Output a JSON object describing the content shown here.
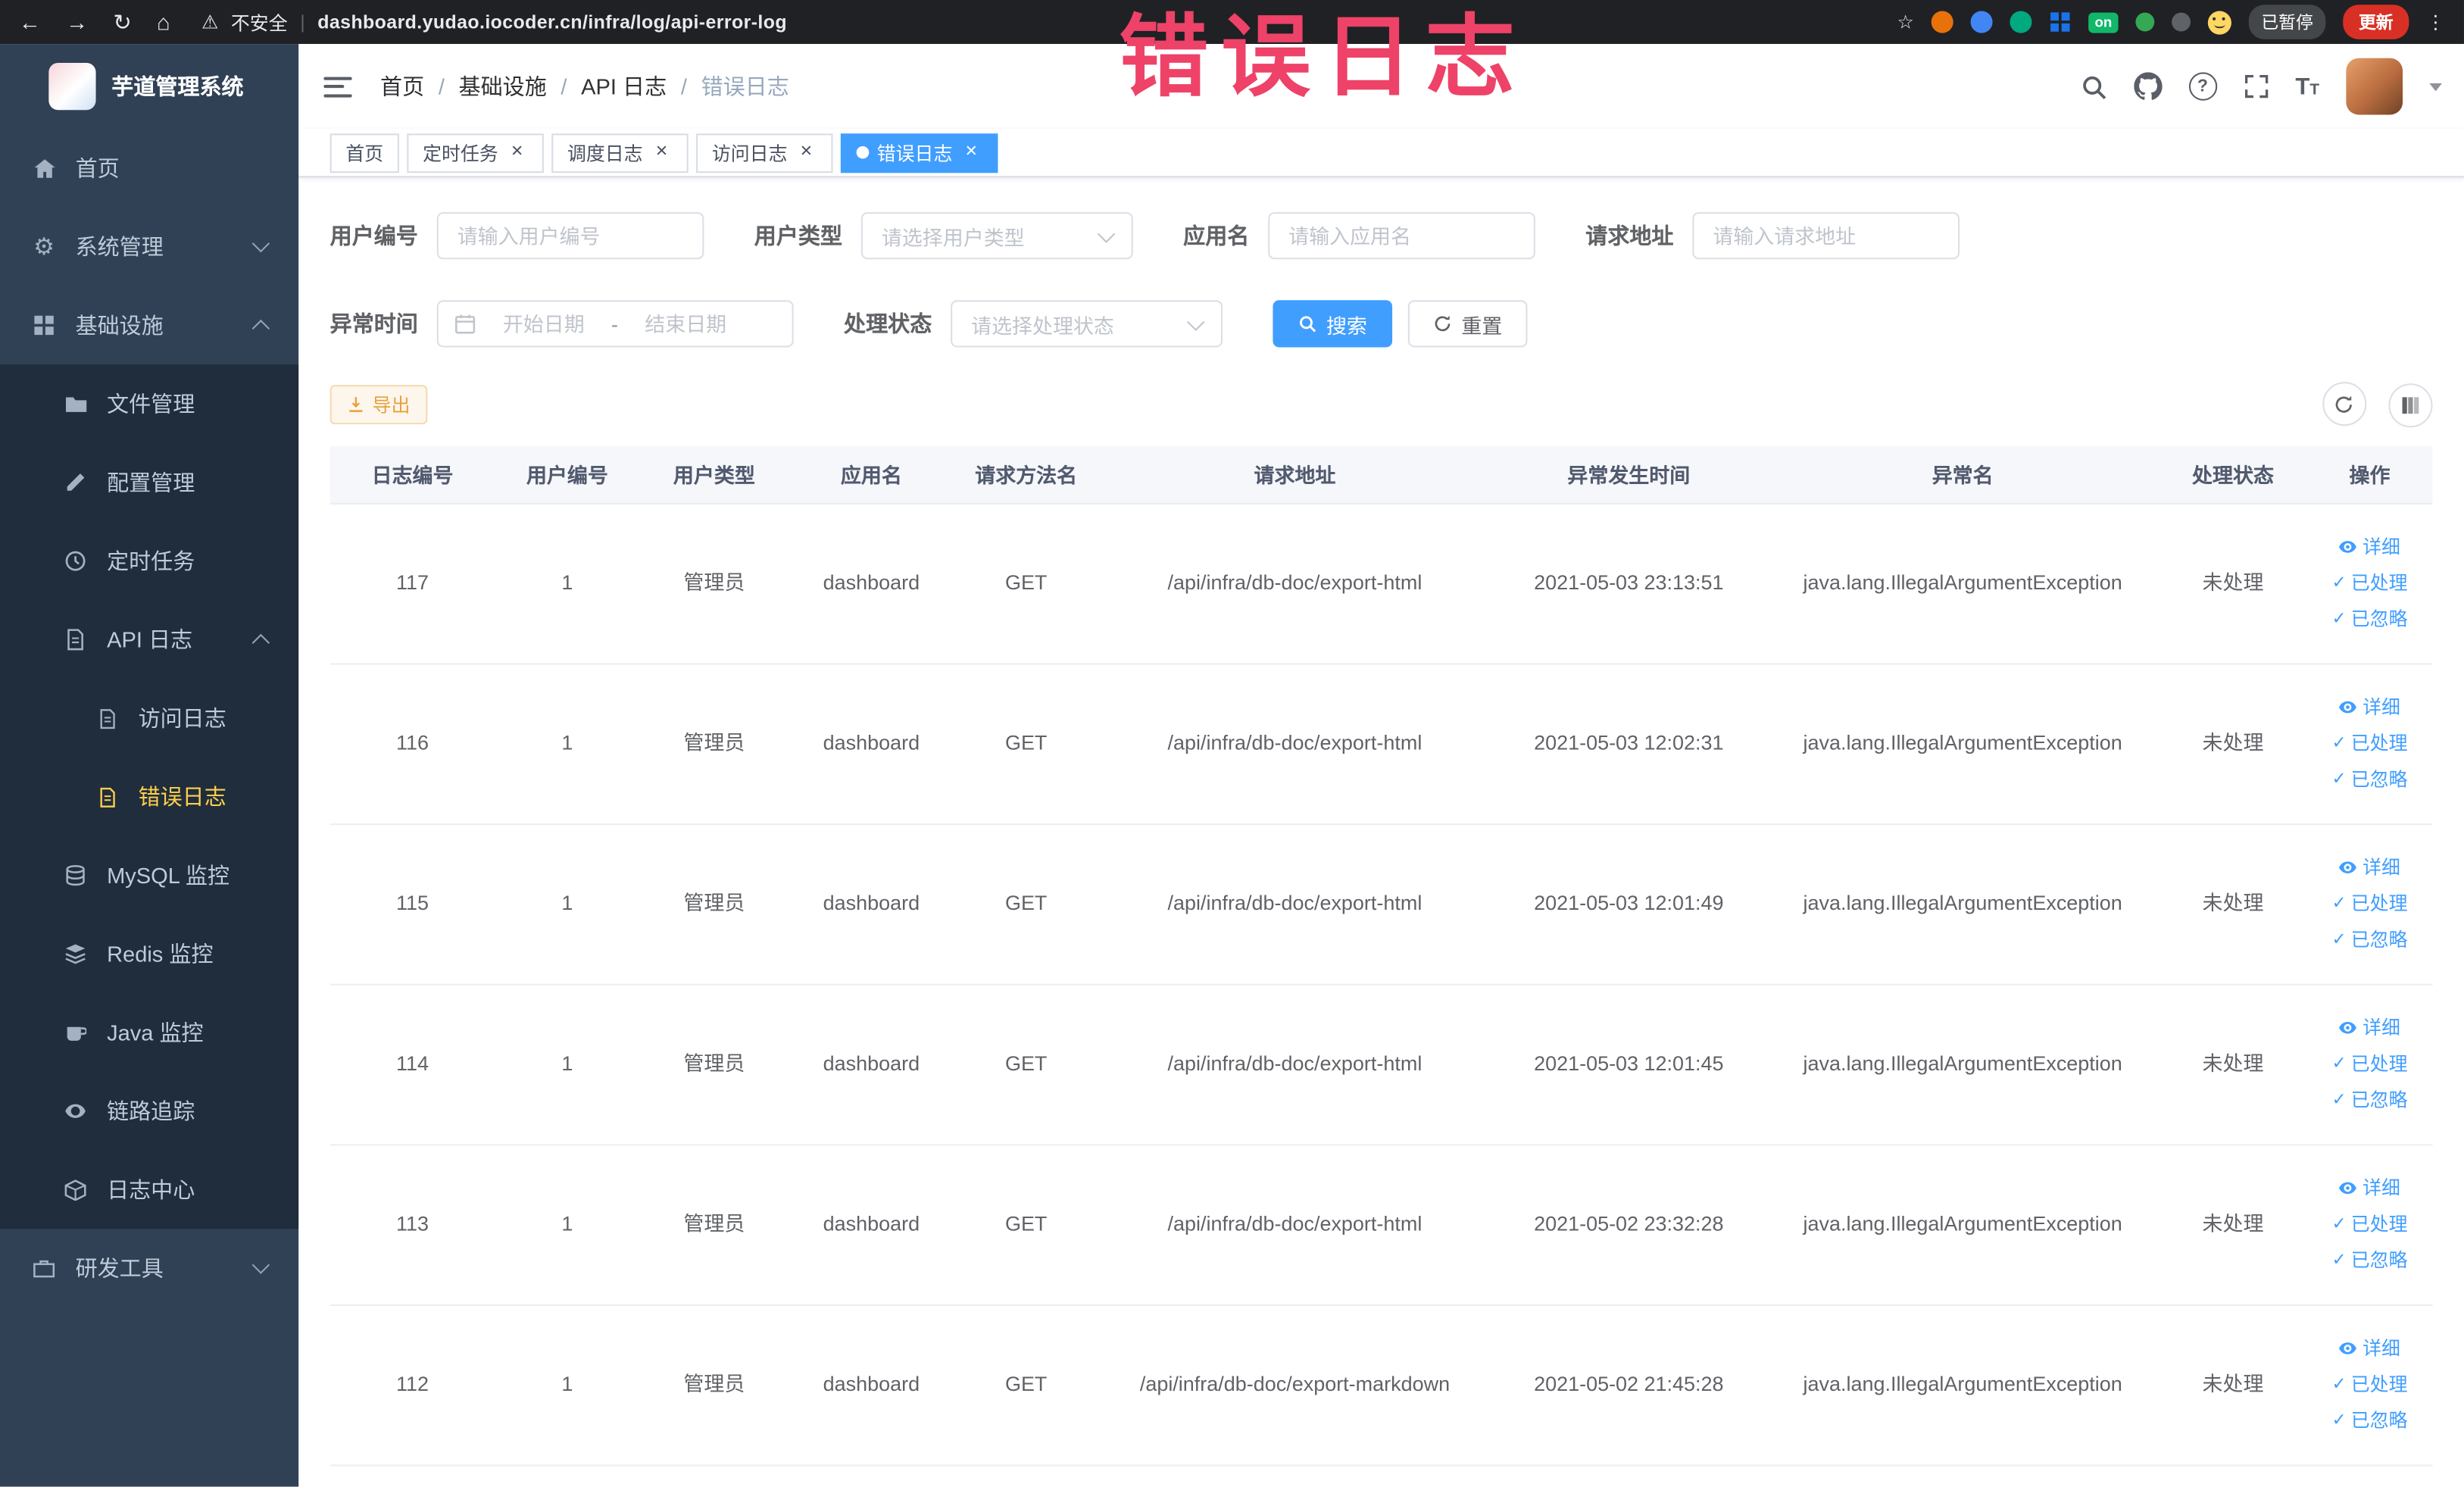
{
  "annotation": {
    "text": "错误日志"
  },
  "browser": {
    "insecure_label": "不安全",
    "url": "dashboard.yudao.iocoder.cn/infra/log/api-error-log",
    "extension_on_badge": "on",
    "paused_badge": "已暂停",
    "update_button": "更新"
  },
  "sidebar": {
    "logo_title": "芋道管理系统",
    "items": [
      {
        "label": "首页"
      },
      {
        "label": "系统管理"
      },
      {
        "label": "基础设施",
        "children": [
          {
            "label": "文件管理"
          },
          {
            "label": "配置管理"
          },
          {
            "label": "定时任务"
          },
          {
            "label": "API 日志",
            "children": [
              {
                "label": "访问日志"
              },
              {
                "label": "错误日志",
                "active": true
              }
            ]
          },
          {
            "label": "MySQL 监控"
          },
          {
            "label": "Redis 监控"
          },
          {
            "label": "Java 监控"
          },
          {
            "label": "链路追踪"
          },
          {
            "label": "日志中心"
          }
        ]
      },
      {
        "label": "研发工具"
      }
    ]
  },
  "header": {
    "separator": "/",
    "breadcrumb": [
      {
        "label": "首页"
      },
      {
        "label": "基础设施"
      },
      {
        "label": "API 日志"
      },
      {
        "label": "错误日志"
      }
    ]
  },
  "tabs": [
    {
      "label": "首页"
    },
    {
      "label": "定时任务"
    },
    {
      "label": "调度日志"
    },
    {
      "label": "访问日志"
    },
    {
      "label": "错误日志"
    }
  ],
  "filters": {
    "user_id": {
      "label": "用户编号",
      "placeholder": "请输入用户编号"
    },
    "user_type": {
      "label": "用户类型",
      "placeholder": "请选择用户类型"
    },
    "app_name": {
      "label": "应用名",
      "placeholder": "请输入应用名"
    },
    "request_url": {
      "label": "请求地址",
      "placeholder": "请输入请求地址"
    },
    "exception_time": {
      "label": "异常时间",
      "start_placeholder": "开始日期",
      "separator": "-",
      "end_placeholder": "结束日期"
    },
    "process_status": {
      "label": "处理状态",
      "placeholder": "请选择处理状态"
    },
    "search_button": "搜索",
    "reset_button": "重置"
  },
  "toolbar": {
    "export_button": "导出"
  },
  "table": {
    "columns": [
      "日志编号",
      "用户编号",
      "用户类型",
      "应用名",
      "请求方法名",
      "请求地址",
      "异常发生时间",
      "异常名",
      "处理状态",
      "操作"
    ],
    "actions": {
      "detail": "详细",
      "processed": "已处理",
      "ignored": "已忽略"
    },
    "rows": [
      {
        "log_id": "117",
        "user_id": "1",
        "user_type": "管理员",
        "app_name": "dashboard",
        "method": "GET",
        "url": "/api/infra/db-doc/export-html",
        "time": "2021-05-03 23:13:51",
        "exception": "java.lang.IllegalArgumentException",
        "status": "未处理"
      },
      {
        "log_id": "116",
        "user_id": "1",
        "user_type": "管理员",
        "app_name": "dashboard",
        "method": "GET",
        "url": "/api/infra/db-doc/export-html",
        "time": "2021-05-03 12:02:31",
        "exception": "java.lang.IllegalArgumentException",
        "status": "未处理"
      },
      {
        "log_id": "115",
        "user_id": "1",
        "user_type": "管理员",
        "app_name": "dashboard",
        "method": "GET",
        "url": "/api/infra/db-doc/export-html",
        "time": "2021-05-03 12:01:49",
        "exception": "java.lang.IllegalArgumentException",
        "status": "未处理"
      },
      {
        "log_id": "114",
        "user_id": "1",
        "user_type": "管理员",
        "app_name": "dashboard",
        "method": "GET",
        "url": "/api/infra/db-doc/export-html",
        "time": "2021-05-03 12:01:45",
        "exception": "java.lang.IllegalArgumentException",
        "status": "未处理"
      },
      {
        "log_id": "113",
        "user_id": "1",
        "user_type": "管理员",
        "app_name": "dashboard",
        "method": "GET",
        "url": "/api/infra/db-doc/export-html",
        "time": "2021-05-02 23:32:28",
        "exception": "java.lang.IllegalArgumentException",
        "status": "未处理"
      },
      {
        "log_id": "112",
        "user_id": "1",
        "user_type": "管理员",
        "app_name": "dashboard",
        "method": "GET",
        "url": "/api/infra/db-doc/export-markdown",
        "time": "2021-05-02 21:45:28",
        "exception": "java.lang.IllegalArgumentException",
        "status": "未处理"
      }
    ]
  }
}
